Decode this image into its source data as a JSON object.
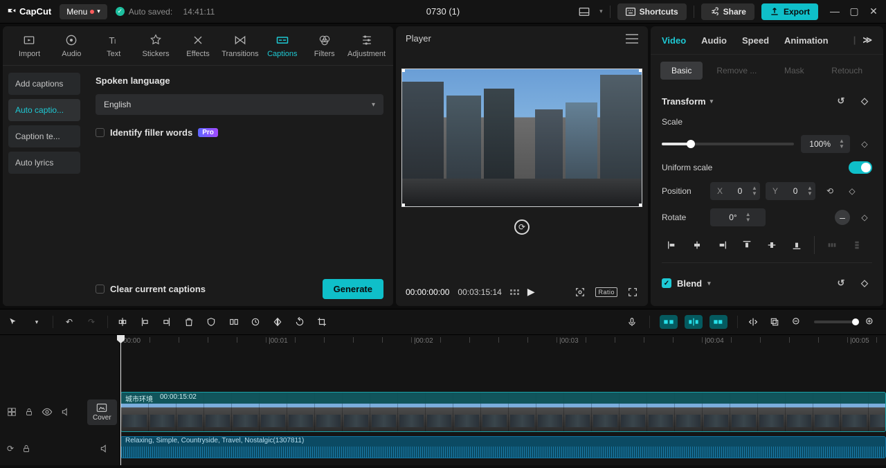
{
  "app": {
    "name": "CapCut",
    "menu_label": "Menu",
    "autosave_label": "Auto saved:",
    "autosave_time": "14:41:11",
    "project_title": "0730 (1)"
  },
  "topbar": {
    "shortcuts": "Shortcuts",
    "share": "Share",
    "export": "Export"
  },
  "tooltabs": [
    {
      "key": "import",
      "label": "Import"
    },
    {
      "key": "audio",
      "label": "Audio"
    },
    {
      "key": "text",
      "label": "Text"
    },
    {
      "key": "stickers",
      "label": "Stickers"
    },
    {
      "key": "effects",
      "label": "Effects"
    },
    {
      "key": "transitions",
      "label": "Transitions"
    },
    {
      "key": "captions",
      "label": "Captions"
    },
    {
      "key": "filters",
      "label": "Filters"
    },
    {
      "key": "adjustment",
      "label": "Adjustment"
    }
  ],
  "sidebar": {
    "items": [
      {
        "key": "add",
        "label": "Add captions"
      },
      {
        "key": "auto",
        "label": "Auto captio..."
      },
      {
        "key": "template",
        "label": "Caption te..."
      },
      {
        "key": "lyrics",
        "label": "Auto lyrics"
      }
    ]
  },
  "captions": {
    "section_title": "Spoken language",
    "language": "English",
    "identify_filler": "Identify filler words",
    "pro": "Pro",
    "clear": "Clear current captions",
    "generate": "Generate"
  },
  "player": {
    "title": "Player",
    "current": "00:00:00:00",
    "total": "00:03:15:14",
    "ratio_label": "Ratio"
  },
  "right": {
    "tabs": {
      "video": "Video",
      "audio": "Audio",
      "speed": "Speed",
      "animation": "Animation"
    },
    "subtabs": {
      "basic": "Basic",
      "remove": "Remove ...",
      "mask": "Mask",
      "retouch": "Retouch"
    },
    "transform": "Transform",
    "scale": "Scale",
    "scale_value": "100%",
    "uniform": "Uniform scale",
    "position": "Position",
    "pos_x_label": "X",
    "pos_x": "0",
    "pos_y_label": "Y",
    "pos_y": "0",
    "rotate": "Rotate",
    "rotate_value": "0°",
    "blend": "Blend"
  },
  "ruler": {
    "labels": [
      "00:00",
      "00:01",
      "00:02",
      "00:03",
      "00:04",
      "00:05"
    ]
  },
  "vclip": {
    "name": "城市环境",
    "dur": "00:00:15:02"
  },
  "aclip": {
    "name": "Relaxing, Simple, Countryside, Travel, Nostalgic(1307811)"
  }
}
